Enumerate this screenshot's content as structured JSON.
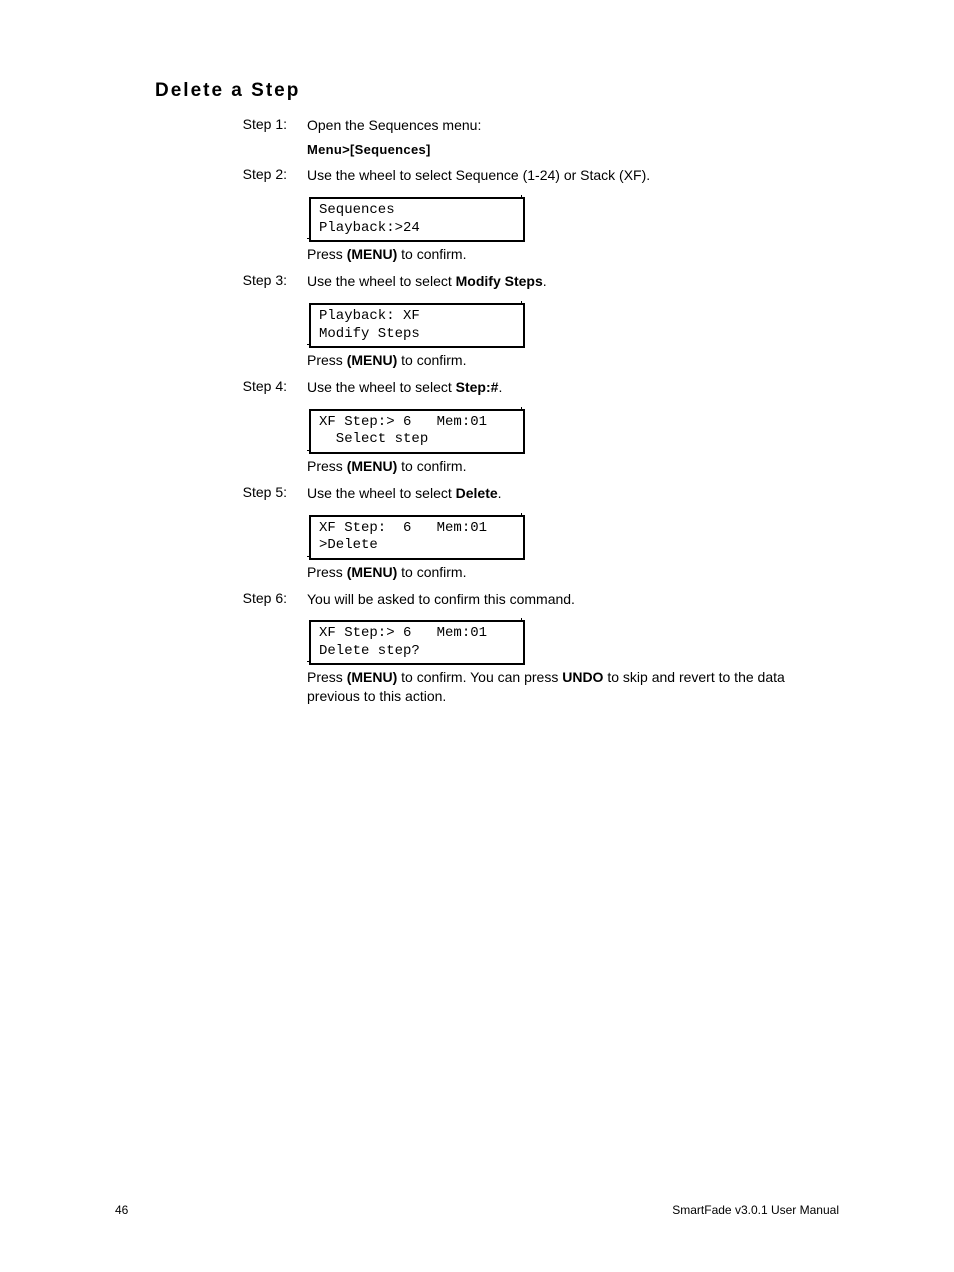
{
  "title": "Delete a Step",
  "steps": [
    {
      "label": "Step 1:",
      "intro": "Open the Sequences menu:",
      "menuPath": "Menu>[Sequences]"
    },
    {
      "label": "Step 2:",
      "intro": "Use the wheel to select Sequence (1-24) or Stack (XF).",
      "screen": "Sequences\nPlayback:>24",
      "press_pre": "Press ",
      "press_bold": "(MENU)",
      "press_post": " to confirm."
    },
    {
      "label": "Step 3:",
      "intro_pre": "Use the wheel to select ",
      "intro_bold": "Modify Steps",
      "intro_post": ".",
      "screen": "Playback: XF\nModify Steps",
      "press_pre": "Press ",
      "press_bold": "(MENU)",
      "press_post": " to confirm."
    },
    {
      "label": "Step 4:",
      "intro_pre": "Use the wheel to select ",
      "intro_bold": "Step:#",
      "intro_post": ".",
      "screen": "XF Step:> 6   Mem:01\n  Select step",
      "press_pre": "Press ",
      "press_bold": "(MENU)",
      "press_post": " to confirm."
    },
    {
      "label": "Step 5:",
      "intro_pre": "Use the wheel to select ",
      "intro_bold": "Delete",
      "intro_post": ".",
      "screen": "XF Step:  6   Mem:01\n>Delete",
      "press_pre": "Press ",
      "press_bold": "(MENU)",
      "press_post": " to confirm."
    },
    {
      "label": "Step 6:",
      "intro": "You will be asked to confirm this command.",
      "screen": "XF Step:> 6   Mem:01\nDelete step?",
      "final_pre": "Press ",
      "final_bold1": "(MENU)",
      "final_mid": " to confirm. You can press ",
      "final_bold2": "UNDO",
      "final_post": " to skip and revert to the data previous to this action."
    }
  ],
  "footer": {
    "pageNum": "46",
    "manual": "SmartFade v3.0.1 User Manual"
  }
}
